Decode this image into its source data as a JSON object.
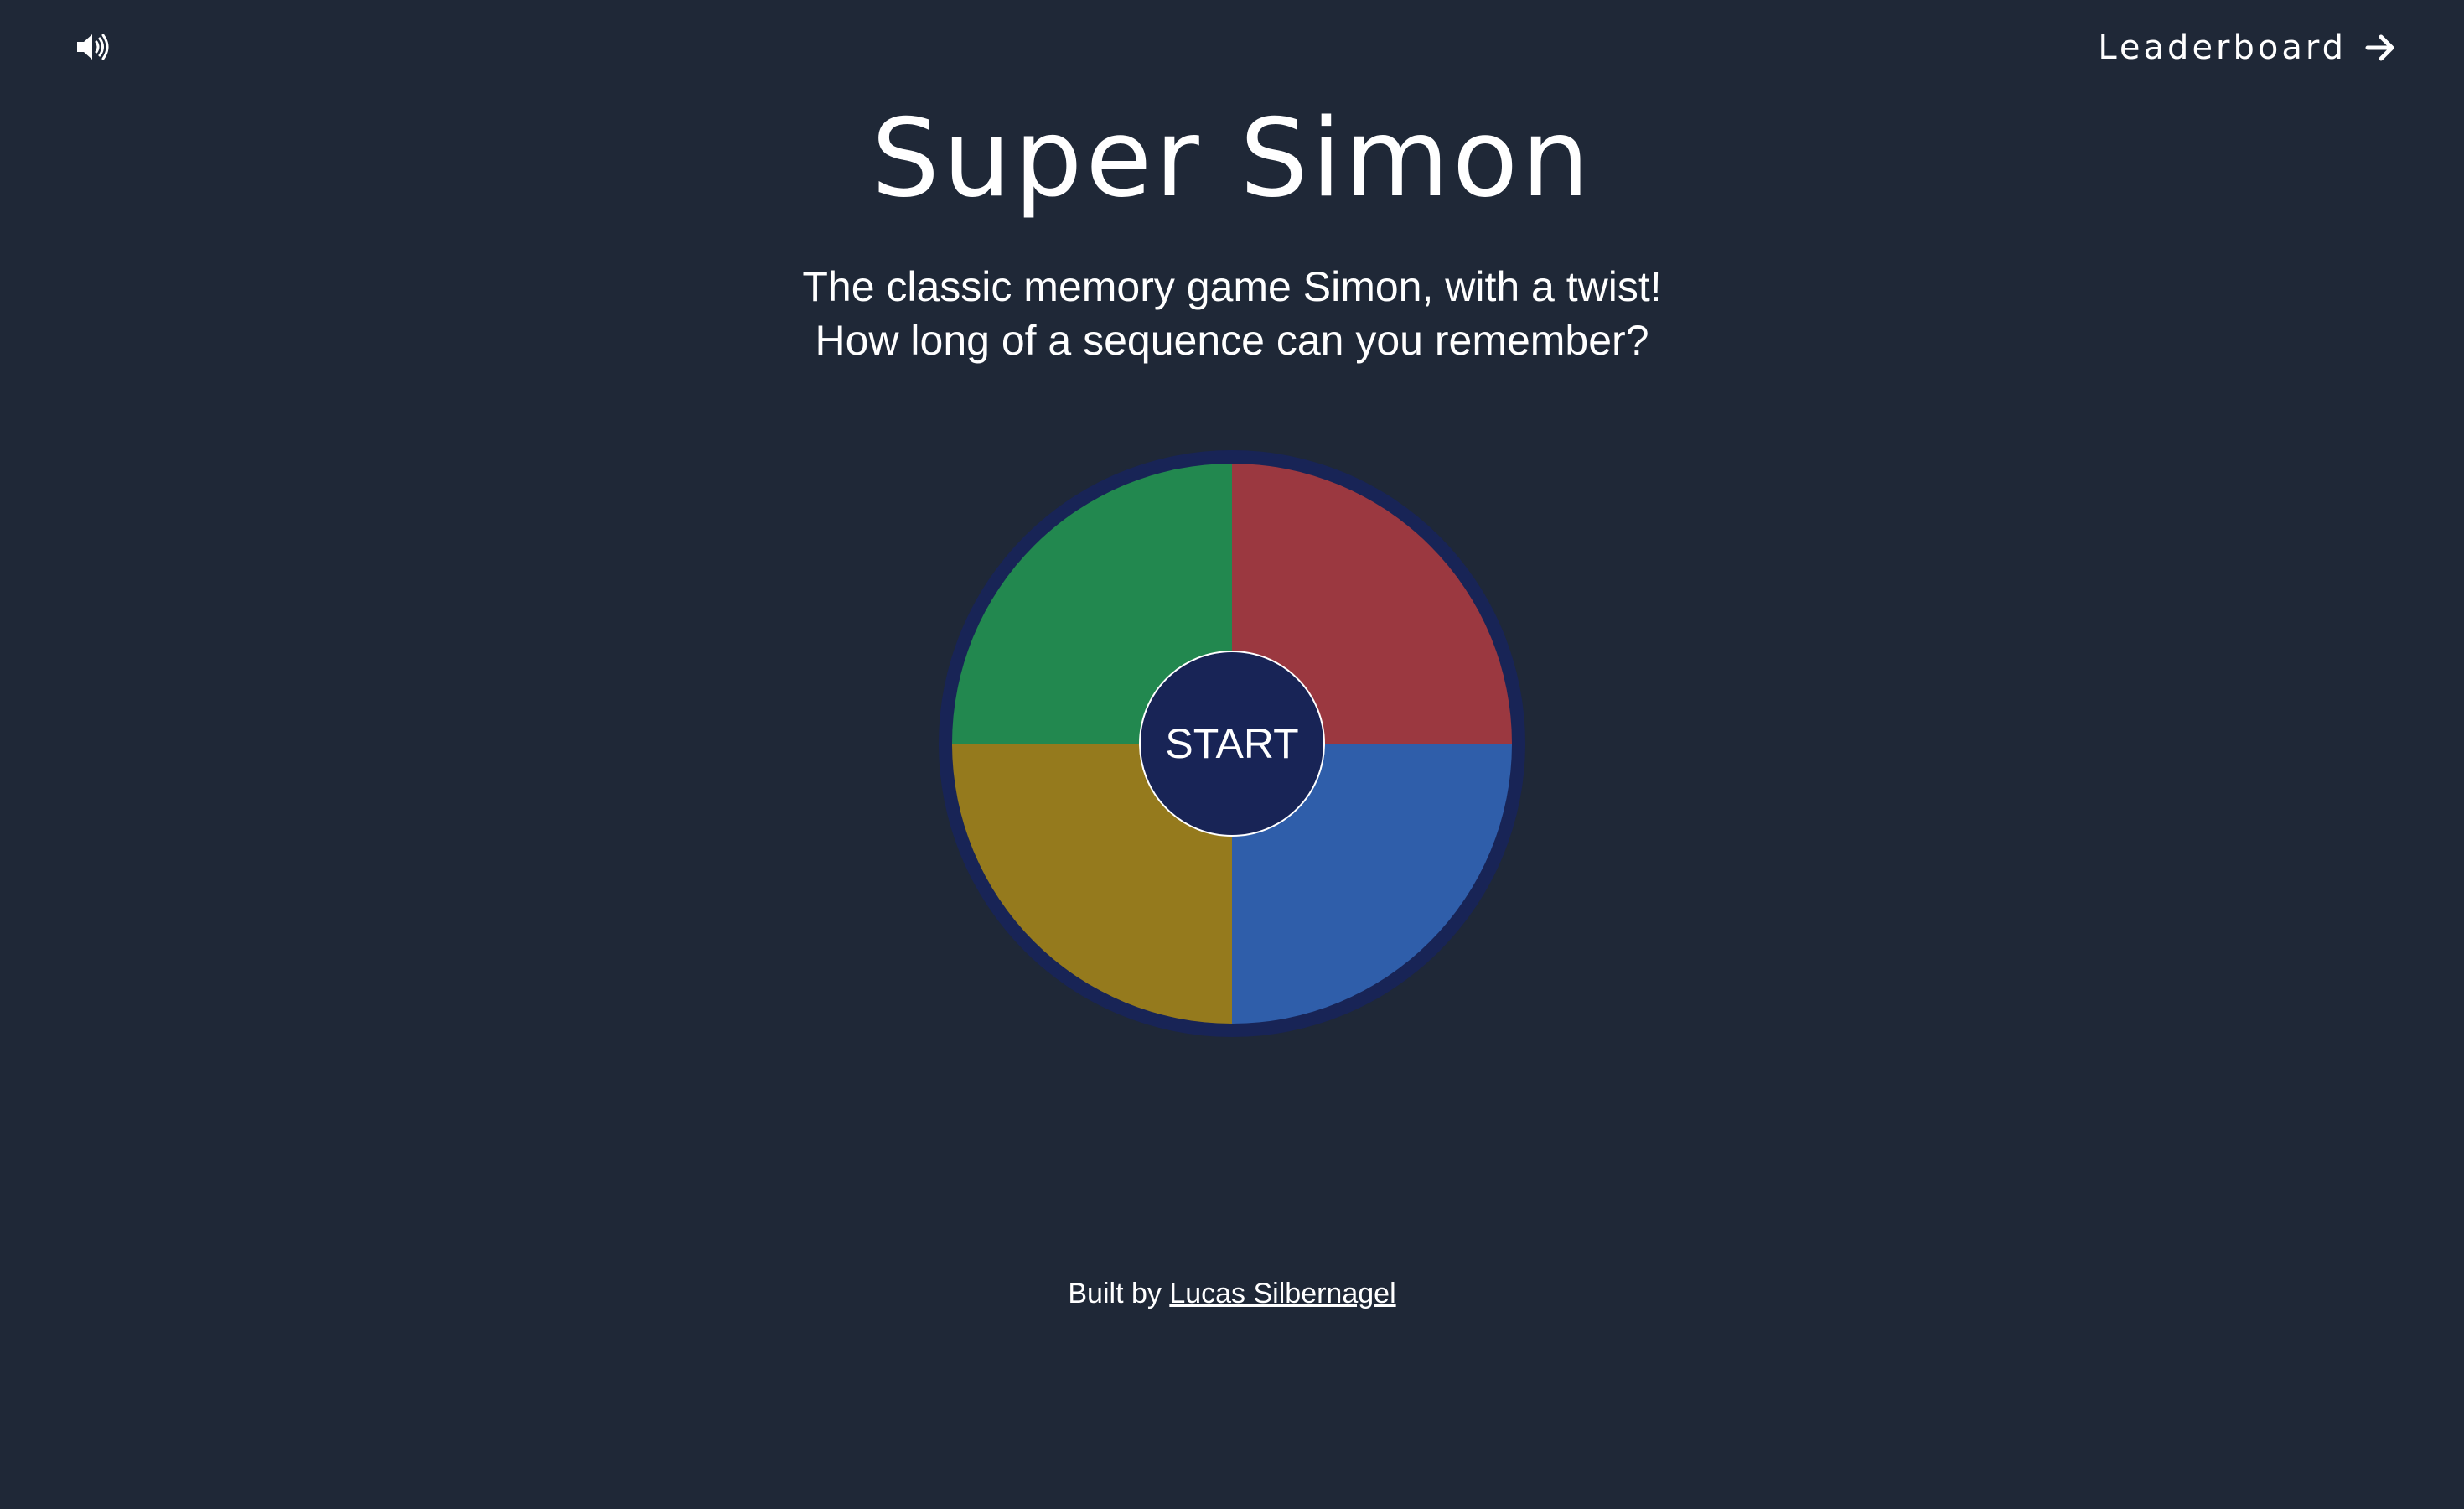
{
  "header": {
    "sound_icon": "volume-up-icon",
    "leaderboard_label": "Leaderboard",
    "leaderboard_icon": "arrow-right-icon"
  },
  "hero": {
    "title": "Super Simon",
    "subtitle_line1": "The classic memory game Simon, with a twist!",
    "subtitle_line2": "How long of a sequence can you remember?"
  },
  "game": {
    "start_label": "START",
    "pads": [
      {
        "position": "top-left",
        "color": "#22884f"
      },
      {
        "position": "top-right",
        "color": "#9b3840"
      },
      {
        "position": "bottom-left",
        "color": "#957a1d"
      },
      {
        "position": "bottom-right",
        "color": "#2f5eaa"
      }
    ],
    "ring_color": "#182456"
  },
  "footer": {
    "built_by_prefix": "Built by",
    "author_name": "Lucas Silbernagel"
  },
  "colors": {
    "background": "#1f2837",
    "text": "#ffffff"
  }
}
